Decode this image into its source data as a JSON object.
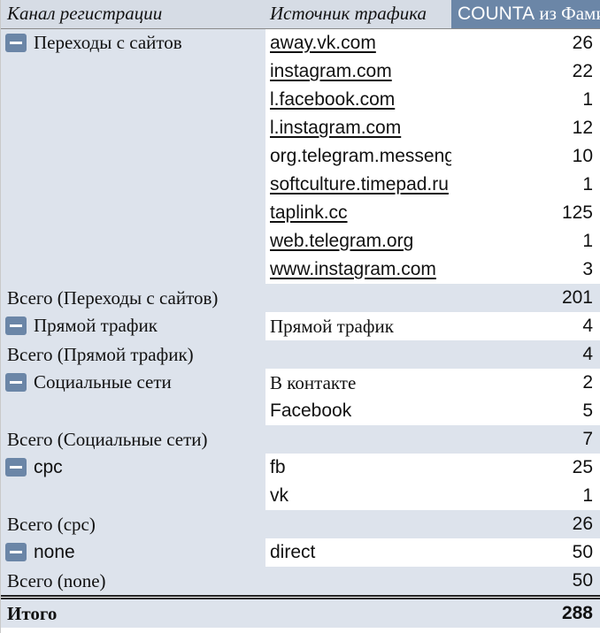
{
  "header": {
    "col1": "Канал регистрации",
    "col2": "Источник трафика",
    "col3_sans": "COUNTA",
    "col3_rest": " из Фамилия"
  },
  "groups": [
    {
      "channel": "Переходы с сайтов",
      "rows": [
        {
          "source": "away.vk.com",
          "count": "26",
          "link": true
        },
        {
          "source": "instagram.com",
          "count": "22",
          "link": true
        },
        {
          "source": "l.facebook.com",
          "count": "1",
          "link": true
        },
        {
          "source": "l.instagram.com",
          "count": "12",
          "link": true
        },
        {
          "source": "org.telegram.messenger",
          "count": "10",
          "link": false
        },
        {
          "source": "softculture.timepad.ru",
          "count": "1",
          "link": true
        },
        {
          "source": "taplink.cc",
          "count": "125",
          "link": true
        },
        {
          "source": "web.telegram.org",
          "count": "1",
          "link": true
        },
        {
          "source": "www.instagram.com",
          "count": "3",
          "link": true
        }
      ],
      "subtotal_label": "Всего (Переходы с сайтов)",
      "subtotal": "201"
    },
    {
      "channel": "Прямой трафик",
      "rows": [
        {
          "source": "Прямой трафик",
          "count": "4",
          "link": false
        }
      ],
      "subtotal_label": "Всего (Прямой трафик)",
      "subtotal": "4"
    },
    {
      "channel": "Социальные сети",
      "rows": [
        {
          "source": "В контакте",
          "count": "2",
          "link": false
        },
        {
          "source": "Facebook",
          "count": "5",
          "link": false
        }
      ],
      "subtotal_label": "Всего (Социальные сети)",
      "subtotal": "7"
    },
    {
      "channel": "cpc",
      "rows": [
        {
          "source": "fb",
          "count": "25",
          "link": false
        },
        {
          "source": "vk",
          "count": "1",
          "link": false
        }
      ],
      "subtotal_label": "Всего (cpc)",
      "subtotal": "26"
    },
    {
      "channel": "none",
      "rows": [
        {
          "source": "direct",
          "count": "50",
          "link": false
        }
      ],
      "subtotal_label": "Всего (none)",
      "subtotal": "50"
    }
  ],
  "total": {
    "label": "Итого",
    "value": "288"
  },
  "colors": {
    "header_value_bg": "#6b86a7",
    "row_tint": "#dde3ec",
    "toggle": "#6b86a7"
  },
  "icons": {
    "collapse": "minus-icon"
  }
}
